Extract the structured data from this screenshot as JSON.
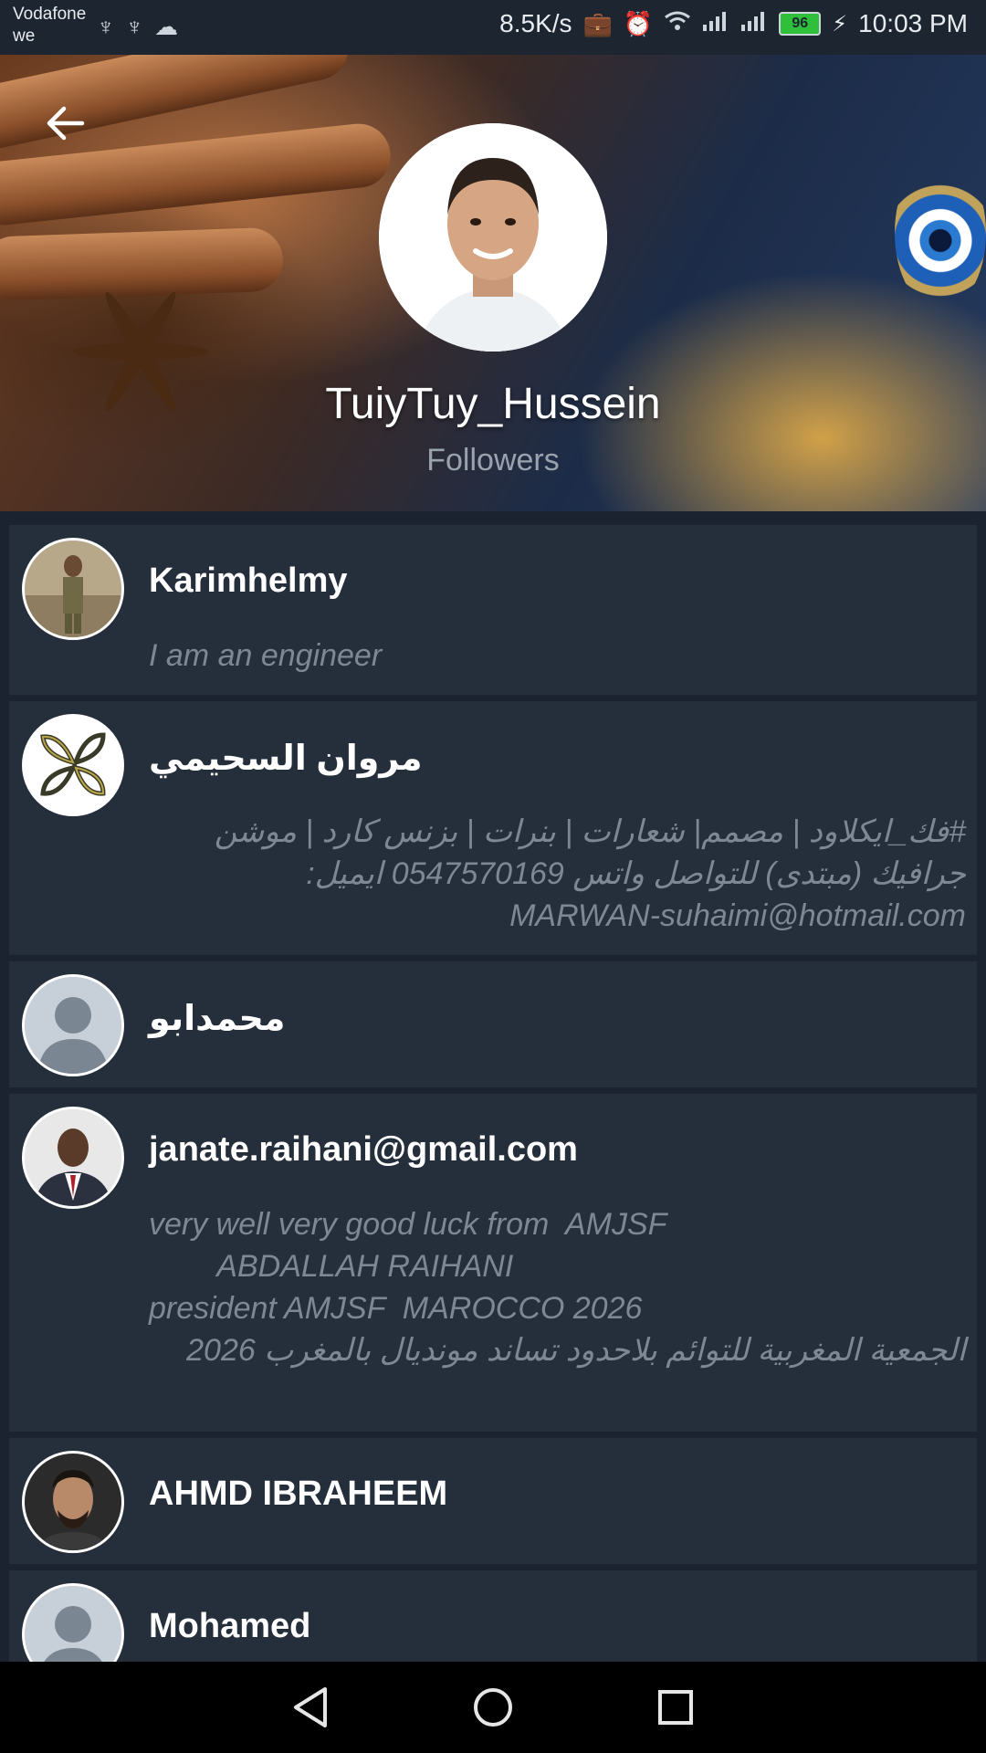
{
  "status_bar": {
    "carrier_line1": "Vodafone",
    "carrier_line2": "we",
    "speed": "8.5K/s",
    "battery": "96",
    "time": "10:03 PM"
  },
  "profile": {
    "name": "TuiyTuy_Hussein",
    "subtitle": "Followers"
  },
  "followers": [
    {
      "name": "Karimhelmy",
      "bio": "I am an engineer"
    },
    {
      "name": "مروان السحيمي",
      "bio": "#فك_ايكلاود | مصمم| شعارات | بنرات | بزنس كارد | موشن جرافيك (مبتدى) للتواصل واتس 0547570169 ايميل: MARWAN-suhaimi@hotmail.com"
    },
    {
      "name": "محمدابو",
      "bio": ""
    },
    {
      "name": "janate.raihani@gmail.com",
      "bio_lines": [
        "very well very good luck from  AMJSF",
        "        ABDALLAH RAIHANI",
        "president AMJSF  MAROCCO 2026"
      ],
      "bio_rtl": "الجمعية المغربية للتوائم بلاحدود تساند  مونديال بالمغرب 2026"
    },
    {
      "name": "AHMD IBRAHEEM",
      "bio": ""
    },
    {
      "name": "Mohamed",
      "bio": ""
    }
  ],
  "icons": {
    "back": "arrow-left-icon",
    "nav_back": "triangle-back-icon",
    "nav_home": "circle-home-icon",
    "nav_recent": "square-recent-icon"
  }
}
